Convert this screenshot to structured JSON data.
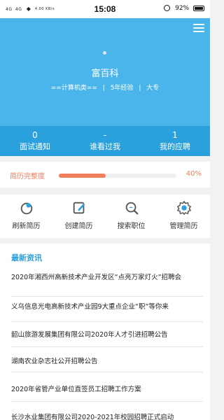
{
  "status_bar": {
    "signal": "4G",
    "network": "4G",
    "speed": "4.00 KB/s",
    "time": "15:08",
    "battery": "92%"
  },
  "profile": {
    "name": "富百科",
    "category": "==计算机类==",
    "experience": "5年经验",
    "education": "大专",
    "separator": "|"
  },
  "stats": [
    {
      "count": "0",
      "label": "面试通知"
    },
    {
      "count": "-",
      "label": "谁看过我"
    },
    {
      "count": "1",
      "label": "我的应聘"
    }
  ],
  "completeness": {
    "label": "简历完整度",
    "percent_text": "40%",
    "value": 0.4
  },
  "actions": [
    {
      "label": "刷新简历",
      "icon": "refresh-icon"
    },
    {
      "label": "创建简历",
      "icon": "edit-icon"
    },
    {
      "label": "搜索职位",
      "icon": "search-icon"
    },
    {
      "label": "管理简历",
      "icon": "gear-icon"
    }
  ],
  "news": {
    "title": "最新资讯",
    "items": [
      "2020年湘西州高新技术产业开发区“点亮万家灯火”招聘会",
      "义乌信息光电高新技术产业园9大重点企业“职”等你来",
      "韶山旅游发展集团有限公司2020年人才引进招聘公告",
      "湖南农业杂志社公开招聘公告",
      "2020年省管产业单位直签员工招聘工作方案",
      "长沙水业集团有限公司2020-2021年校园招聘正式启动"
    ]
  },
  "colors": {
    "header_bg": "#4ab5ea",
    "stats_bg": "#2aa0dc",
    "accent_orange": "#ef7e5a",
    "news_title": "#2aa0dc"
  }
}
